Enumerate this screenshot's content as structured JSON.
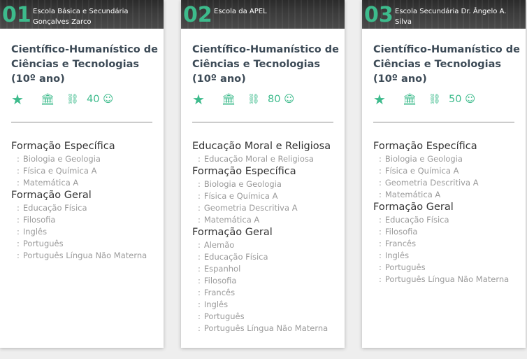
{
  "cards": [
    {
      "number": "01",
      "school": "Escola Básica e Secundária Gonçalves Zarco",
      "course": "Científico-Humanístico de Ciências e Tecnologias (10º ano)",
      "score": "40",
      "groups": [
        {
          "title": "Formação Específica",
          "subjects": [
            "Biologia e Geologia",
            "Física e Química A",
            "Matemática A"
          ]
        },
        {
          "title": "Formação Geral",
          "subjects": [
            "Educação Física",
            "Filosofia",
            "Inglês",
            "Português",
            "Português Língua Não Materna"
          ]
        }
      ]
    },
    {
      "number": "02",
      "school": "Escola da APEL",
      "course": "Científico-Humanístico de Ciências e Tecnologias (10º ano)",
      "score": "80",
      "groups": [
        {
          "title": "Educação Moral e Religiosa",
          "subjects": [
            "Educação Moral e Religiosa"
          ]
        },
        {
          "title": "Formação Específica",
          "subjects": [
            "Biologia e Geologia",
            "Física e Química A",
            "Geometria Descritiva A",
            "Matemática A"
          ]
        },
        {
          "title": "Formação Geral",
          "subjects": [
            "Alemão",
            "Educação Física",
            "Espanhol",
            "Filosofia",
            "Francês",
            "Inglês",
            "Português",
            "Português Língua Não Materna"
          ]
        }
      ]
    },
    {
      "number": "03",
      "school": "Escola Secundária Dr. Ângelo A. Silva",
      "course": "Científico-Humanístico de Ciências e Tecnologias (10º ano)",
      "score": "50",
      "groups": [
        {
          "title": "Formação Específica",
          "subjects": [
            "Biologia e Geologia",
            "Física e Química A",
            "Geometria Descritiva A",
            "Matemática A"
          ]
        },
        {
          "title": "Formação Geral",
          "subjects": [
            "Educação Física",
            "Filosofia",
            "Francês",
            "Inglês",
            "Português",
            "Português Língua Não Materna"
          ]
        }
      ]
    }
  ],
  "icons": {
    "star": "star-icon",
    "institution": "institution-icon",
    "link": "link-icon",
    "smiley": "smiley-icon"
  },
  "colors": {
    "accent": "#3dbb8c",
    "course_title": "#3c4a56",
    "subject_text": "#9a9a9a",
    "divider": "#8d8d8d"
  }
}
